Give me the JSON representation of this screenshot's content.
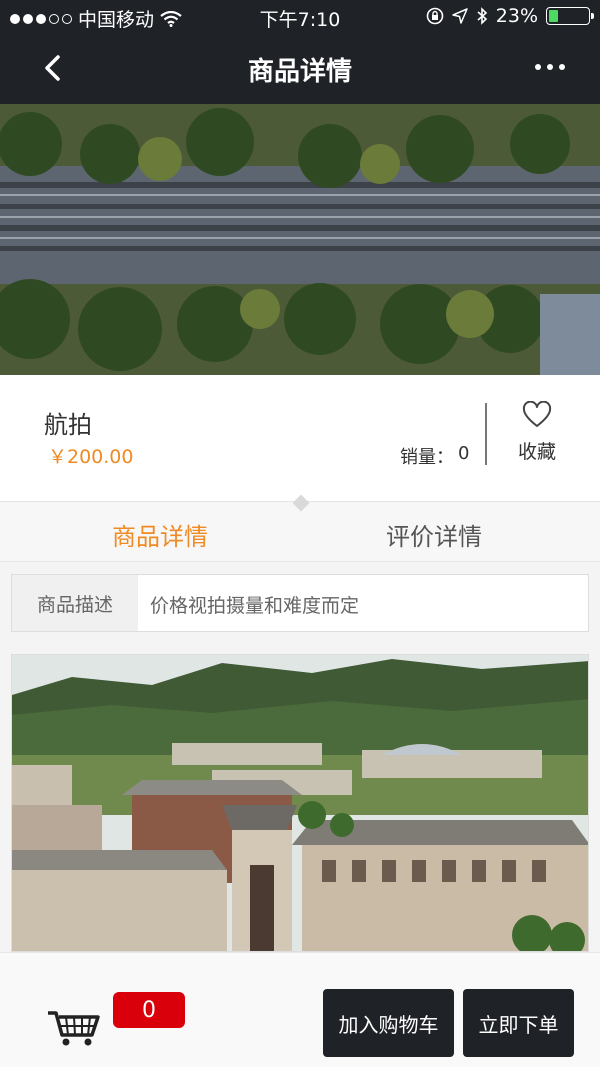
{
  "status_bar": {
    "carrier": "中国移动",
    "time": "下午7:10",
    "battery_percent": "23%",
    "battery_level": 0.23
  },
  "nav": {
    "title": "商品详情",
    "back_icon": "chevron-left-icon",
    "more_icon": "more-dots-icon"
  },
  "product": {
    "name": "航拍",
    "price": "￥200.00",
    "sales_label": "销量：",
    "sales_value": "0",
    "favorite_label": "收藏"
  },
  "tabs": [
    {
      "label": "商品详情",
      "active": true
    },
    {
      "label": "评价详情",
      "active": false
    }
  ],
  "description": {
    "label": "商品描述",
    "value": "价格视拍摄量和难度而定"
  },
  "bottom_bar": {
    "cart_count": "0",
    "add_to_cart": "加入购物车",
    "order_now": "立即下单"
  },
  "colors": {
    "accent": "#f08a24",
    "dark": "#1f2227",
    "badge": "#d9000b"
  }
}
